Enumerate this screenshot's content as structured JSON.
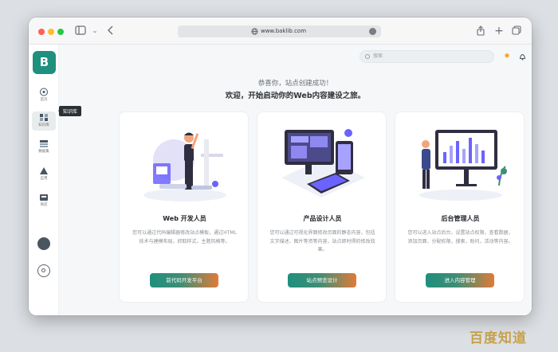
{
  "browser": {
    "url": "www.baklib.com"
  },
  "app": {
    "logo_letter": "B",
    "tooltip": "知识库",
    "sidebar_items": [
      {
        "label": "首页",
        "icon": "home-icon"
      },
      {
        "label": "知识库",
        "icon": "library-icon"
      },
      {
        "label": "数据集",
        "icon": "dataset-icon"
      },
      {
        "label": "应用",
        "icon": "apps-icon"
      },
      {
        "label": "商店",
        "icon": "store-icon"
      }
    ]
  },
  "header": {
    "search_placeholder": "搜索"
  },
  "main": {
    "greeting": "恭喜你，站点创建成功！",
    "welcome": "欢迎，开始启动你的Web内容建设之旅。",
    "cards": [
      {
        "title": "Web 开发人员",
        "desc": "您可以通过代码编辑器修改站点模板，通过HTML技术与建模布局，抓取样式，主题风格等。",
        "cta": "前代码开发平台"
      },
      {
        "title": "产品设计人员",
        "desc": "您可以通过可视化界面修改页面的静态内容，包括文字描述、图片等资等内容，站点即时得的修改效果。",
        "cta": "站点预览设计"
      },
      {
        "title": "后台管理人员",
        "desc": "您可以进入站点后台，设置站点权限，查看数据，添加页面，分配权限，搜索，助问，活动等内容。",
        "cta": "进入内容管理"
      }
    ]
  },
  "colors": {
    "brand": "#1f8f7e",
    "accent_orange": "#e07b39"
  },
  "watermark": "百度知道"
}
